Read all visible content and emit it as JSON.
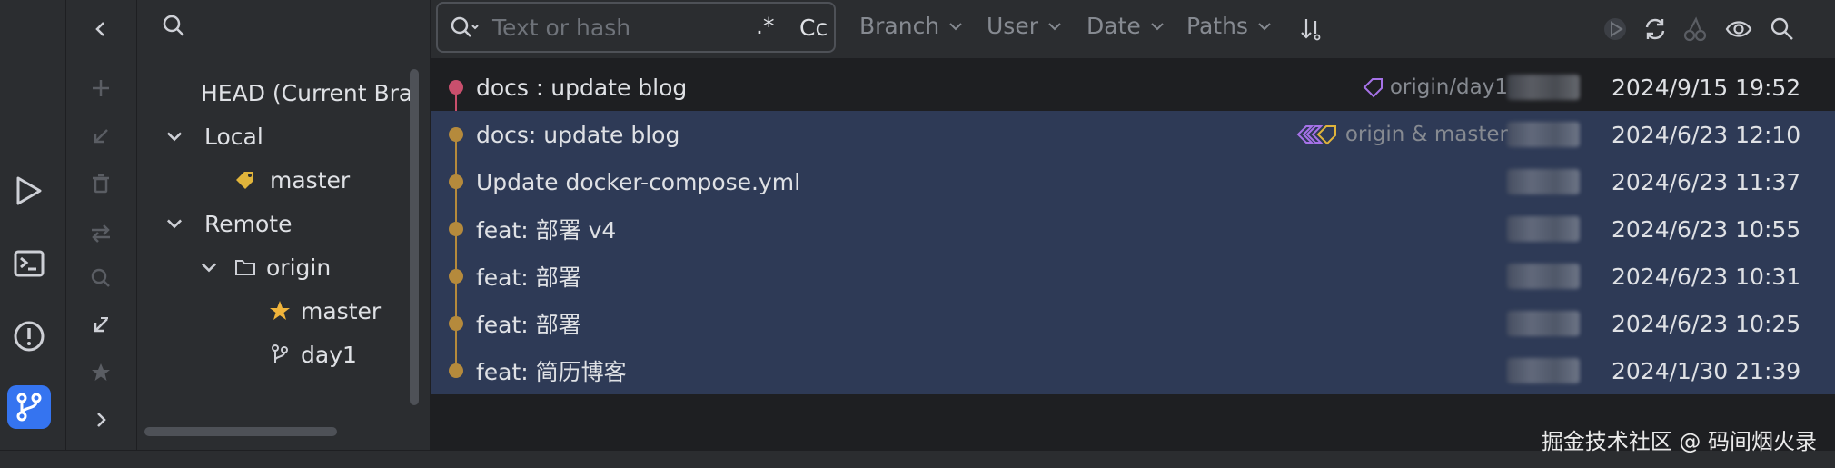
{
  "activity_bar": {
    "items": [
      {
        "name": "run-icon"
      },
      {
        "name": "terminal-icon"
      },
      {
        "name": "problems-icon"
      },
      {
        "name": "git-icon",
        "active": true
      }
    ]
  },
  "tree": {
    "rows": [
      {
        "label": "HEAD (Current Bra"
      },
      {
        "label": "Local"
      },
      {
        "label": "master"
      },
      {
        "label": "Remote"
      },
      {
        "label": "origin"
      },
      {
        "label": "master"
      },
      {
        "label": "day1"
      }
    ]
  },
  "filter": {
    "search_placeholder": "Text or hash",
    "regex_label": ".*",
    "case_label": "Cc",
    "branch": "Branch",
    "user": "User",
    "date": "Date",
    "paths": "Paths"
  },
  "commits": [
    {
      "message": "docs : update blog",
      "ref": "origin/day1",
      "date": "2024/9/15 19:52",
      "selected": false,
      "color": "#c94f6d"
    },
    {
      "message": "docs: update blog",
      "ref": "origin & master",
      "date": "2024/6/23 12:10",
      "selected": true,
      "color": "#b58a3c"
    },
    {
      "message": "Update docker-compose.yml",
      "ref": "",
      "date": "2024/6/23 11:37",
      "selected": true,
      "color": "#b58a3c"
    },
    {
      "message": "feat: 部署 v4",
      "ref": "",
      "date": "2024/6/23 10:55",
      "selected": true,
      "color": "#b58a3c"
    },
    {
      "message": "feat: 部署",
      "ref": "",
      "date": "2024/6/23 10:31",
      "selected": true,
      "color": "#b58a3c"
    },
    {
      "message": "feat: 部署",
      "ref": "",
      "date": "2024/6/23 10:25",
      "selected": true,
      "color": "#b58a3c"
    },
    {
      "message": "feat: 简历博客",
      "ref": "",
      "date": "2024/1/30 21:39",
      "selected": true,
      "color": "#b58a3c"
    }
  ],
  "watermark": "掘金技术社区 @ 码间烟火录",
  "colors": {
    "accent": "#3574f0",
    "selection": "#2e3a56",
    "head_branch": "#c94f6d",
    "main_branch": "#b58a3c"
  }
}
